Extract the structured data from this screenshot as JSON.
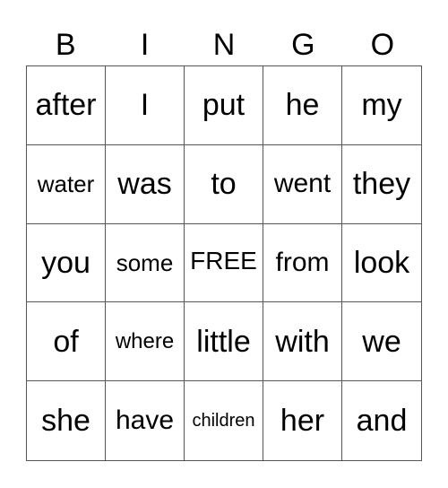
{
  "header": {
    "letters": [
      "B",
      "I",
      "N",
      "G",
      "O"
    ]
  },
  "board": {
    "rows": [
      [
        "after",
        "I",
        "put",
        "he",
        "my"
      ],
      [
        "water",
        "was",
        "to",
        "went",
        "they"
      ],
      [
        "you",
        "some",
        "FREE",
        "from",
        "look"
      ],
      [
        "of",
        "where",
        "little",
        "with",
        "we"
      ],
      [
        "she",
        "have",
        "children",
        "her",
        "and"
      ]
    ]
  }
}
